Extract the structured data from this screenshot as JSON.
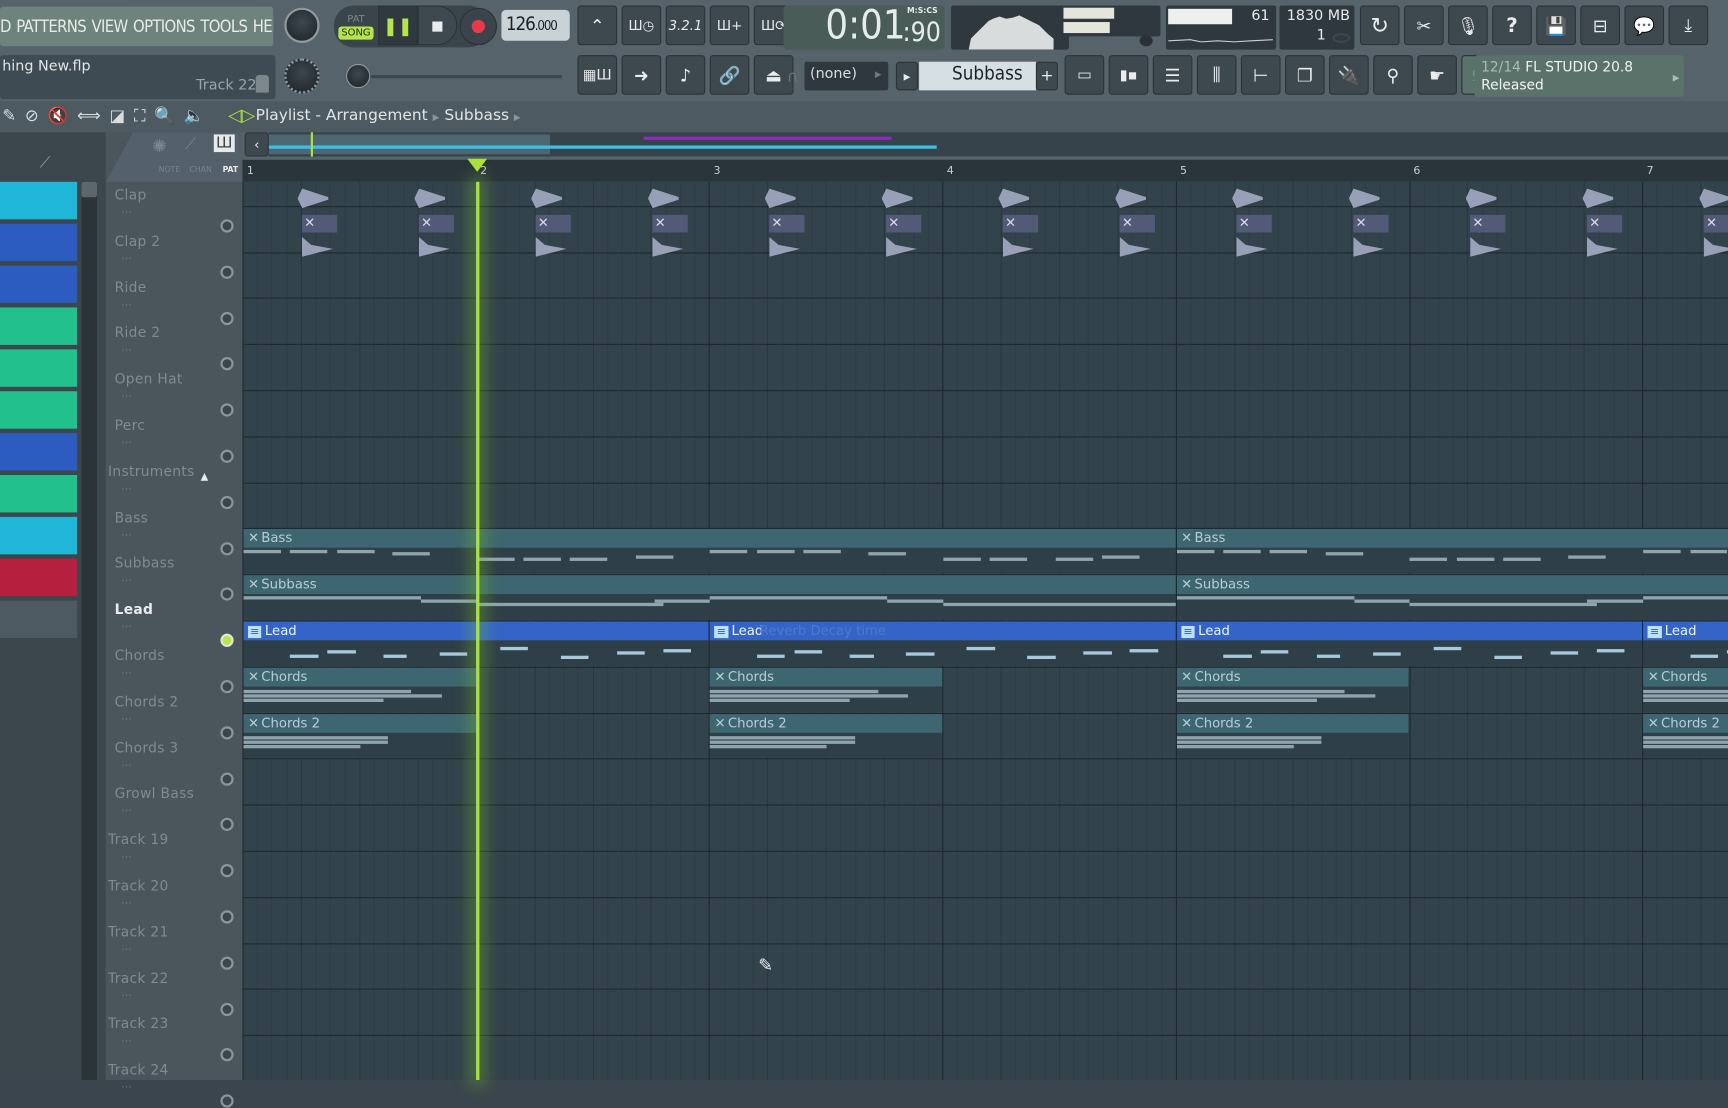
{
  "menu": {
    "items": [
      "D",
      "PATTERNS",
      "VIEW",
      "OPTIONS",
      "TOOLS",
      "HELP"
    ]
  },
  "project": {
    "filename": "hing New.flp",
    "track_hint": "Track 22"
  },
  "transport": {
    "pat_label": "PAT",
    "song_label": "SONG",
    "mode": "SONG",
    "tempo": "126",
    "tempo_decimal": ".000"
  },
  "time_display": {
    "value": "0:01",
    "cs": ":90",
    "format": "M:S:CS"
  },
  "cpu": {
    "value": "61",
    "memory": "1830 MB",
    "polyphony": "1"
  },
  "snap": {
    "value": "(none)"
  },
  "pattern_selector": {
    "value": "Subbass",
    "add_label": "+"
  },
  "news": {
    "counter": "12/14",
    "title": "FL STUDIO 20.8",
    "status": "Released"
  },
  "playlist": {
    "breadcrumb": [
      "Playlist - Arrangement",
      "Subbass"
    ],
    "tabs": [
      "NOTE",
      "CHAN",
      "PAT"
    ],
    "active_tab": "PAT",
    "ruler": [
      "1",
      "2",
      "3",
      "4",
      "5",
      "6",
      "7"
    ],
    "playhead_bar": 2,
    "tracks": [
      {
        "name": "Clap",
        "active": false
      },
      {
        "name": "Clap 2",
        "active": false
      },
      {
        "name": "Ride",
        "active": false
      },
      {
        "name": "Ride 2",
        "active": false
      },
      {
        "name": "Open Hat",
        "active": false
      },
      {
        "name": "Perc",
        "active": false
      },
      {
        "name": "Instruments",
        "active": false,
        "group": true
      },
      {
        "name": "Bass",
        "active": false
      },
      {
        "name": "Subbass",
        "active": false
      },
      {
        "name": "Lead",
        "active": true
      },
      {
        "name": "Chords",
        "active": false
      },
      {
        "name": "Chords 2",
        "active": false
      },
      {
        "name": "Chords 3",
        "active": false
      },
      {
        "name": "Growl Bass",
        "active": false
      },
      {
        "name": "Track 19",
        "active": false
      },
      {
        "name": "Track 20",
        "active": false
      },
      {
        "name": "Track 21",
        "active": false
      },
      {
        "name": "Track 22",
        "active": false
      },
      {
        "name": "Track 23",
        "active": false
      },
      {
        "name": "Track 24",
        "active": false
      }
    ],
    "clips": {
      "bass": "Bass",
      "subbass": "Subbass",
      "lead": "Lead",
      "lead_automation": "Reverb Decay time",
      "chords": "Chords",
      "chords2": "Chords 2"
    },
    "dots": "..."
  },
  "colors": {
    "accent": "#a9e23b",
    "lead_clip": "#3464c8",
    "pattern_clip": "#3d6670",
    "channel_cyan": "#1fb6d8",
    "channel_blue": "#2d5cc0",
    "channel_green": "#22c08c",
    "channel_red": "#b5203e"
  }
}
